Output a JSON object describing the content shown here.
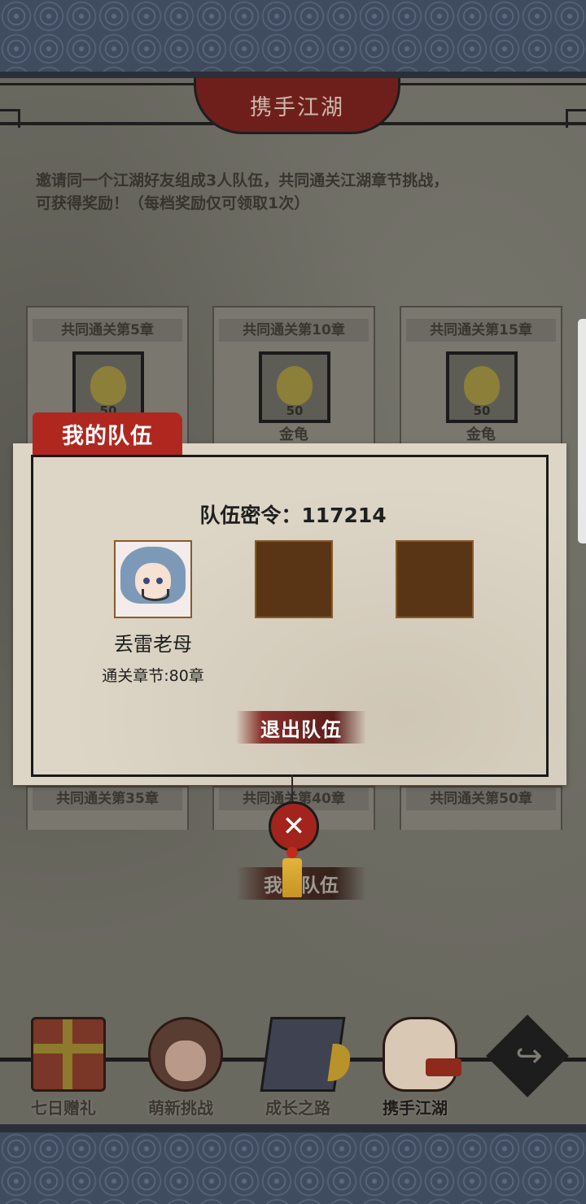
{
  "header": {
    "title": "携手江湖"
  },
  "description": {
    "line1": "邀请同一个江湖好友组成3人队伍，共同通关江湖章节挑战，",
    "line2": "可获得奖励！（每档奖励仅可领取1次）"
  },
  "reward_cards_top": [
    {
      "title": "共同通关第5章",
      "item": "",
      "qty": "50"
    },
    {
      "title": "共同通关第10章",
      "item": "金龟",
      "qty": "50"
    },
    {
      "title": "共同通关第15章",
      "item": "金龟",
      "qty": "50"
    }
  ],
  "reward_cards_bottom": [
    {
      "title": "共同通关第35章"
    },
    {
      "title": "共同通关第40章"
    },
    {
      "title": "共同通关第50章"
    }
  ],
  "team_modal": {
    "tab_label": "我的队伍",
    "code_label": "队伍密令：117214",
    "member": {
      "name": "丢雷老母",
      "chapter": "通关章节:80章"
    },
    "quit_label": "退出队伍",
    "close_icon": "close-icon"
  },
  "behind_button": {
    "label": "我的队伍"
  },
  "bottom_nav": [
    {
      "label": "七日赠礼",
      "icon": "gift-box-icon"
    },
    {
      "label": "萌新挑战",
      "icon": "girl-portrait-icon"
    },
    {
      "label": "成长之路",
      "icon": "book-icon"
    },
    {
      "label": "携手江湖",
      "icon": "handshake-icon"
    }
  ],
  "share": {
    "icon": "share-arrow-icon"
  },
  "colors": {
    "accent_red": "#b0271f",
    "dark_red": "#6e1f1c",
    "parchment": "#ddd5c6",
    "slot_brown": "#5a3515"
  }
}
